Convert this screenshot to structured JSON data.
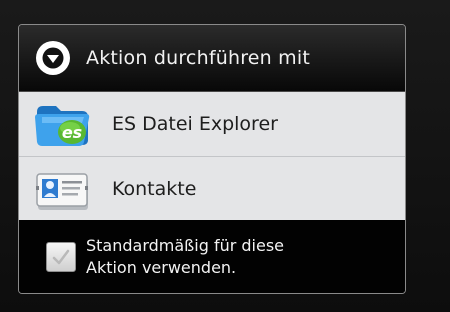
{
  "dialog": {
    "title": "Aktion durchführen mit",
    "title_icon": "chevron-down-circle-icon",
    "apps": [
      {
        "label": "ES Datei Explorer",
        "icon": "es-file-explorer-icon"
      },
      {
        "label": "Kontakte",
        "icon": "contacts-card-icon"
      }
    ],
    "default_option": {
      "line1": "Standardmäßig für diese",
      "line2": "Aktion verwenden.",
      "checked": false
    }
  },
  "colors": {
    "header_bg": "#080808",
    "list_bg": "#e4e5e7",
    "footer_bg": "#020202",
    "folder_blue": "#2f86d6",
    "es_green": "#58b832"
  }
}
